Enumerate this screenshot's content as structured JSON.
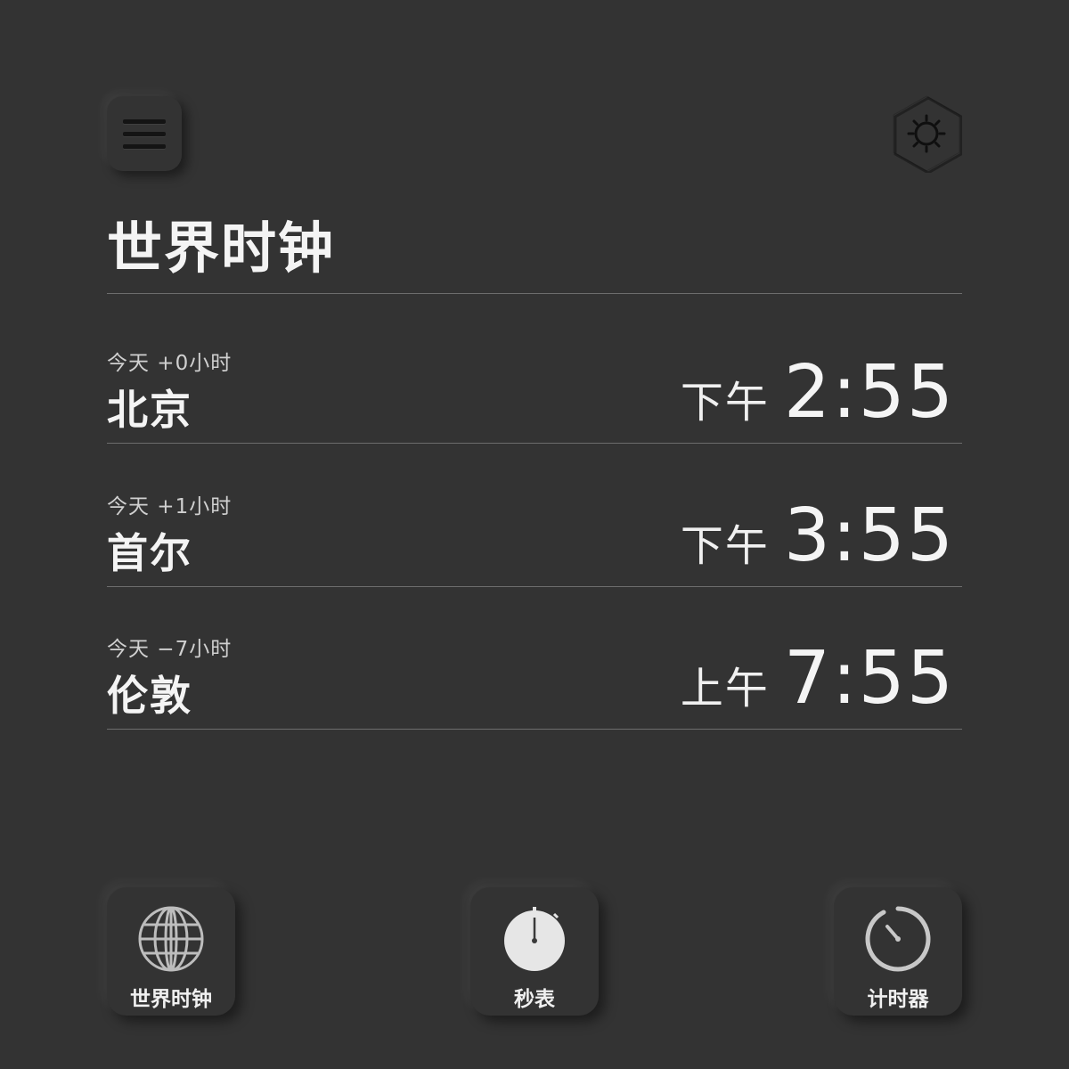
{
  "header": {
    "menu_icon": "hamburger-menu-icon",
    "theme_icon": "sun-icon",
    "title": "世界时钟"
  },
  "clocks": [
    {
      "offset": "今天  +0小时",
      "city": "北京",
      "ampm": "下午",
      "time": "2:55"
    },
    {
      "offset": "今天  +1小时",
      "city": "首尔",
      "ampm": "下午",
      "time": "3:55"
    },
    {
      "offset": "今天  −7小时",
      "city": "伦敦",
      "ampm": "上午",
      "time": "7:55"
    }
  ],
  "nav": [
    {
      "icon": "globe-icon",
      "label": "世界时钟"
    },
    {
      "icon": "stopwatch-icon",
      "label": "秒表"
    },
    {
      "icon": "timer-icon",
      "label": "计时器"
    }
  ],
  "colors": {
    "background": "#333333",
    "text": "#f4f4f4",
    "divider": "#6d6d6d"
  }
}
